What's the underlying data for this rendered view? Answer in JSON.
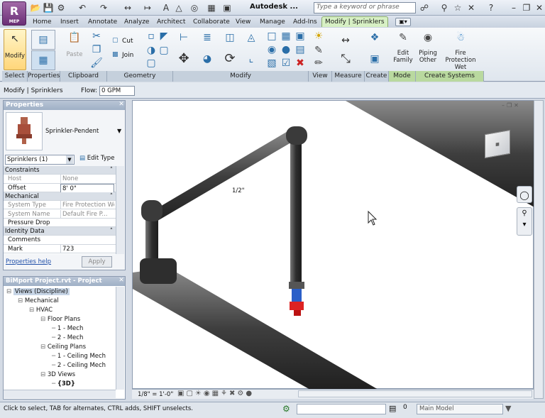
{
  "app": {
    "logo": "R",
    "logo_sub": "MEP",
    "title": "Autodesk ...",
    "search_placeholder": "Type a keyword or phrase"
  },
  "tabs": [
    "Home",
    "Insert",
    "Annotate",
    "Analyze",
    "Architect",
    "Collaborate",
    "View",
    "Manage",
    "Add-Ins",
    "Modify | Sprinklers"
  ],
  "ribbon": {
    "modify": "Modify",
    "paste": "Paste",
    "cut": "Cut",
    "join": "Join",
    "edit_family": [
      "Edit",
      "Family"
    ],
    "piping": [
      "Piping",
      "Other"
    ],
    "fire": [
      "Fire Protection",
      "Wet"
    ],
    "panels": [
      "Select",
      "Properties",
      "Clipboard",
      "Geometry",
      "Modify",
      "View",
      "Measure",
      "Create",
      "Mode",
      "Create Systems"
    ]
  },
  "options": {
    "context": "Modify | Sprinklers",
    "flow_label": "Flow:",
    "flow_value": "0 GPM"
  },
  "properties": {
    "header": "Properties",
    "type_name": "Sprinkler-Pendent",
    "selector": "Sprinklers (1)",
    "edit_type": "Edit Type",
    "rows": [
      {
        "label": "Constraints",
        "group": true
      },
      {
        "label": "Host",
        "value": "None",
        "dim": true
      },
      {
        "label": "Offset",
        "value": "8' 0\"",
        "edit": true
      },
      {
        "label": "Mechanical",
        "group": true
      },
      {
        "label": "System Type",
        "value": "Fire Protection Wet",
        "dim": true
      },
      {
        "label": "System Name",
        "value": "Default Fire P...",
        "dim": true
      },
      {
        "label": "Pressure Drop",
        "value": ""
      },
      {
        "label": "Identity Data",
        "group": true
      },
      {
        "label": "Comments",
        "value": ""
      },
      {
        "label": "Mark",
        "value": "723"
      }
    ],
    "help": "Properties help",
    "apply": "Apply"
  },
  "browser": {
    "header": "BiMport Project.rvt - Project Brow...",
    "items": [
      {
        "label": "Views (Discipline)",
        "level": 0,
        "selected": true
      },
      {
        "label": "Mechanical",
        "level": 1
      },
      {
        "label": "HVAC",
        "level": 2
      },
      {
        "label": "Floor Plans",
        "level": 3
      },
      {
        "label": "1 - Mech",
        "level": 4
      },
      {
        "label": "2 - Mech",
        "level": 4
      },
      {
        "label": "Ceiling Plans",
        "level": 3
      },
      {
        "label": "1 - Ceiling Mech",
        "level": 4
      },
      {
        "label": "2 - Ceiling Mech",
        "level": 4
      },
      {
        "label": "3D Views",
        "level": 3
      },
      {
        "label": "{3D}",
        "level": 4,
        "bold": true
      }
    ]
  },
  "canvas": {
    "pipe_label": "1/2\"",
    "scale": "1/8\" = 1'-0\""
  },
  "status": {
    "hint": "Click to select, TAB for alternates, CTRL adds, SHIFT unselects.",
    "model": "Main Model"
  },
  "colors": {
    "ribbon_ctx": "#d7f0c4",
    "panel_hdr": "#a9b8cc",
    "pipe": "#4a4a4a",
    "sprinkler": "#d22"
  }
}
